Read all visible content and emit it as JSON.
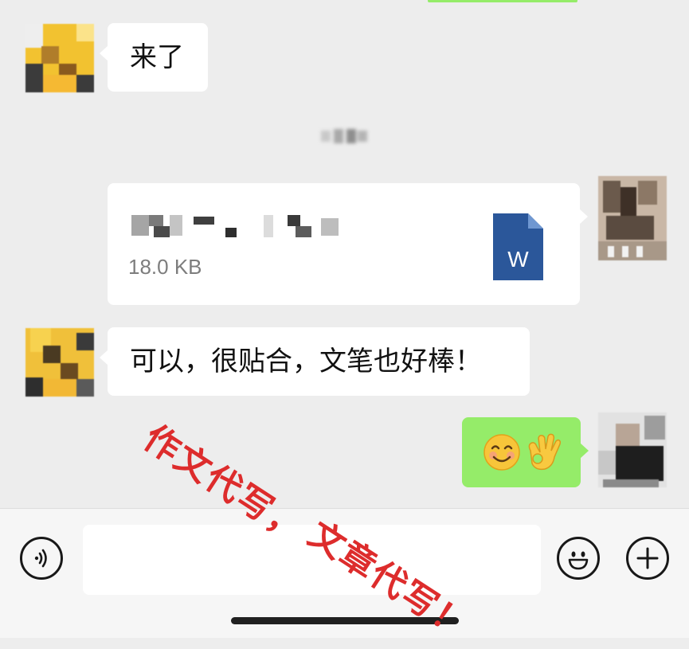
{
  "messages": {
    "m1_text": "来了",
    "m3_text": "可以，很贴合，文笔也好棒！",
    "m4_emojis": [
      "😊",
      "👌"
    ]
  },
  "file_card": {
    "size": "18.0 KB",
    "icon_letter": "W",
    "icon": "word-document-icon"
  },
  "input_bar": {
    "voice_icon": "voice-icon",
    "emoji_icon": "emoji-icon",
    "plus_icon": "plus-icon"
  },
  "watermark": {
    "line1": "作文代写，",
    "line2": "文章代写！"
  },
  "colors": {
    "background": "#ededed",
    "bubble_white": "#ffffff",
    "bubble_green": "#95ec69",
    "word_blue": "#2b579a",
    "watermark_red": "#dd2c2c"
  }
}
